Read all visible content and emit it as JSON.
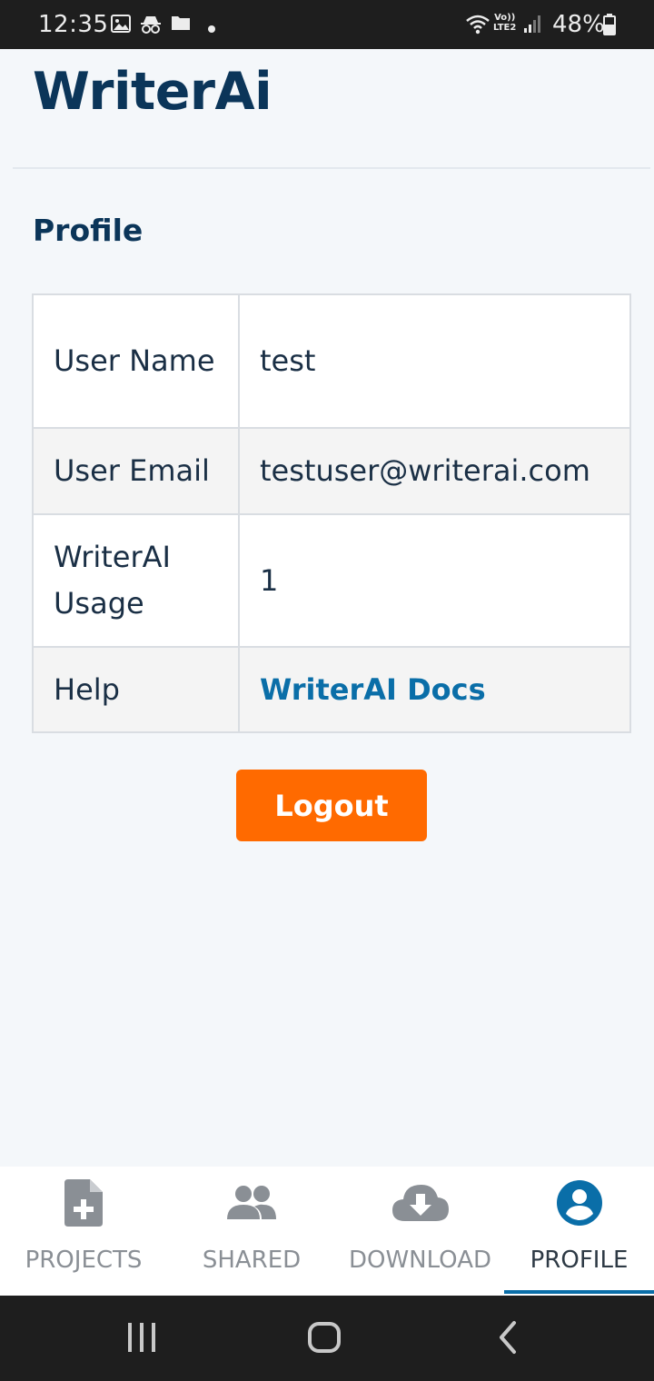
{
  "status_bar": {
    "time": "12:35",
    "network_label_top": "Vo))",
    "network_label_bottom": "LTE2",
    "battery": "48%",
    "icons": [
      "image-icon",
      "incognito-icon",
      "folder-icon",
      "dot-icon",
      "wifi-icon",
      "signal-icon",
      "battery-icon"
    ]
  },
  "app": {
    "title": "WriterAi"
  },
  "profile": {
    "section_title": "Profile",
    "rows": [
      {
        "key": "User Name",
        "value": "test"
      },
      {
        "key": "User Email",
        "value": "testuser@writerai.com"
      },
      {
        "key": "WriterAI Usage",
        "value": "1"
      },
      {
        "key": "Help",
        "value": "WriterAI Docs"
      }
    ],
    "logout_label": "Logout"
  },
  "bottom_nav": {
    "items": [
      {
        "label": "PROJECTS",
        "icon": "add-document-icon"
      },
      {
        "label": "SHARED",
        "icon": "people-icon"
      },
      {
        "label": "DOWNLOAD",
        "icon": "cloud-download-icon"
      },
      {
        "label": "PROFILE",
        "icon": "account-circle-icon"
      }
    ],
    "active": "PROFILE"
  },
  "system_nav": {
    "icons": [
      "recent-apps-icon",
      "home-icon",
      "back-icon"
    ]
  },
  "colors": {
    "brand_dark": "#0b3559",
    "accent_orange": "#ff6a00",
    "link_blue": "#0a6ea8"
  }
}
